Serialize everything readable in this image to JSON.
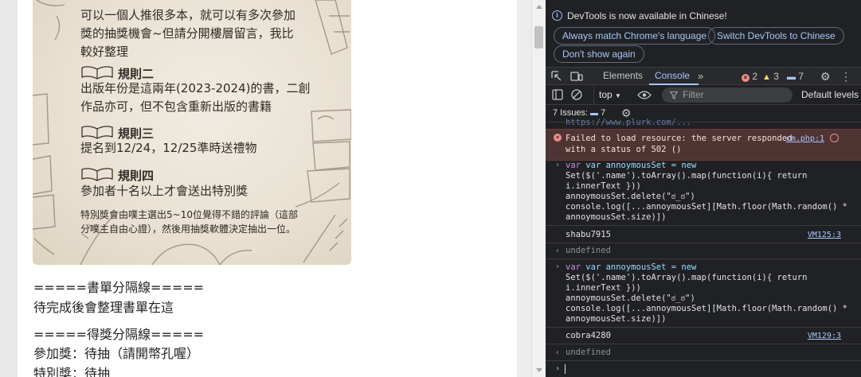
{
  "poster": {
    "intro_line1": "可以一個人推很多本，就可以有多次參加",
    "intro_line2": "獎的抽獎機會~但請分開樓層留言，我比",
    "intro_line3": "較好整理",
    "rules": [
      {
        "title": "規則二",
        "lines": [
          "出版年份是這兩年(2023-2024)的書，二創",
          "作品亦可，但不包含重新出版的書籍"
        ]
      },
      {
        "title": "規則三",
        "lines": [
          "提名到12/24，12/25準時送禮物"
        ]
      },
      {
        "title": "規則四",
        "lines": [
          "參加者十名以上才會送出特別獎"
        ]
      }
    ],
    "note_line1": "特別獎會由噗主選出5~10位覺得不錯的評論（這部",
    "note_line2": "分噗主自由心證），然後用抽獎軟體決定抽出一位。"
  },
  "article": {
    "divider_booklist": "=====書單分隔線=====",
    "booklist_text": "待完成後會整理書單在這",
    "divider_winners": "=====得獎分隔線=====",
    "participation_prize": "參加獎：待抽（請開幣孔喔）",
    "special_prize": "特別獎：待抽"
  },
  "devtools": {
    "info_message": "DevTools is now available in Chinese!",
    "btn_always_match": "Always match Chrome's language",
    "btn_switch": "Switch DevTools to Chinese",
    "btn_dont_show": "Don't show again",
    "tabs": [
      "Elements",
      "Console"
    ],
    "error_count": "2",
    "warning_count": "3",
    "message_count": "7",
    "context": "top",
    "filter_placeholder": "Filter",
    "levels": "Default levels",
    "issues_label": "7 Issues:",
    "issues_count": "7",
    "error_message_line1": "Failed to load resource: the server responded",
    "error_message_line2": "with a status of 502 ()",
    "error_source": "cm.php:1",
    "entries": [
      {
        "code": [
          "var annoymousSet = new",
          "Set($('.name').toArray().map(function(i){ return",
          "i.innerText }))",
          "annoymousSet.delete(\"ಠ_ಠ\")",
          "console.log([...annoymousSet][Math.floor(Math.random() *",
          "annoymousSet.size)])"
        ],
        "output": "shabu7915",
        "source": "VM125:3",
        "result": "undefined"
      },
      {
        "code": [
          "var annoymousSet = new",
          "Set($('.name').toArray().map(function(i){ return",
          "i.innerText }))",
          "annoymousSet.delete(\"ಠ_ಠ\")",
          "console.log([...annoymousSet][Math.floor(Math.random() *",
          "annoymousSet.size)])"
        ],
        "output": "cobra4280",
        "source": "VM129:3",
        "result": "undefined"
      }
    ]
  },
  "colors": {
    "devtools_bg": "#202124",
    "accent": "#a8c7fa",
    "error_bg": "#4e3534"
  }
}
